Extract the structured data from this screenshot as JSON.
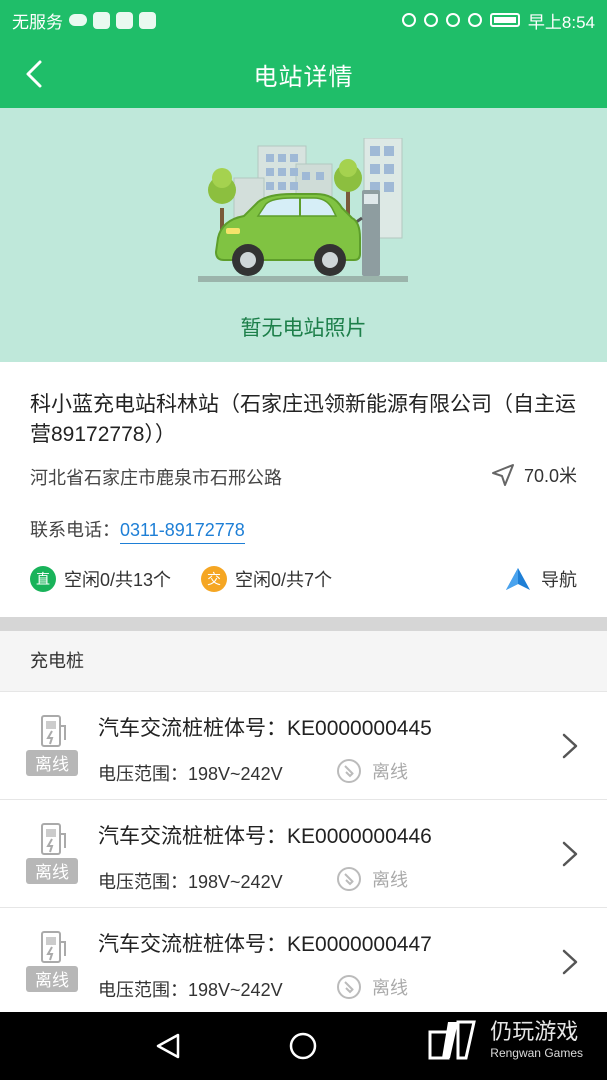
{
  "status_bar": {
    "carrier": "无服务",
    "time": "早上8:54"
  },
  "header": {
    "title": "电站详情"
  },
  "hero": {
    "caption": "暂无电站照片"
  },
  "station": {
    "name": "科小蓝充电站科林站（石家庄迅领新能源有限公司（自主运营89172778））",
    "address": "河北省石家庄市鹿泉市石邢公路",
    "distance": "70.0米",
    "phone_label": "联系电话：",
    "phone": "0311-89172778",
    "dc_badge": "直",
    "dc_status": "空闲0/共13个",
    "ac_badge": "交",
    "ac_status": "空闲0/共7个",
    "nav_label": "导航"
  },
  "section": {
    "title": "充电桩"
  },
  "piles": [
    {
      "name": "汽车交流桩桩体号：KE0000000445",
      "voltage": "电压范围：198V~242V",
      "state": "离线",
      "badge": "离线"
    },
    {
      "name": "汽车交流桩桩体号：KE0000000446",
      "voltage": "电压范围：198V~242V",
      "state": "离线",
      "badge": "离线"
    },
    {
      "name": "汽车交流桩桩体号：KE0000000447",
      "voltage": "电压范围：198V~242V",
      "state": "离线",
      "badge": "离线"
    }
  ],
  "watermark": {
    "title": "仍玩游戏",
    "subtitle": "Rengwan Games"
  },
  "colors": {
    "brand_green": "#1fbe69",
    "hero_bg": "#bfe8da",
    "link_blue": "#1e7fd6",
    "dc_green": "#19b35a",
    "ac_orange": "#f5a623"
  },
  "icons": {
    "back": "chevron-left-icon",
    "location": "navigation-arrow-icon",
    "navigate": "navigate-icon",
    "pile": "charging-pile-icon",
    "offline": "offline-plug-icon",
    "chevron": "chevron-right-icon"
  }
}
